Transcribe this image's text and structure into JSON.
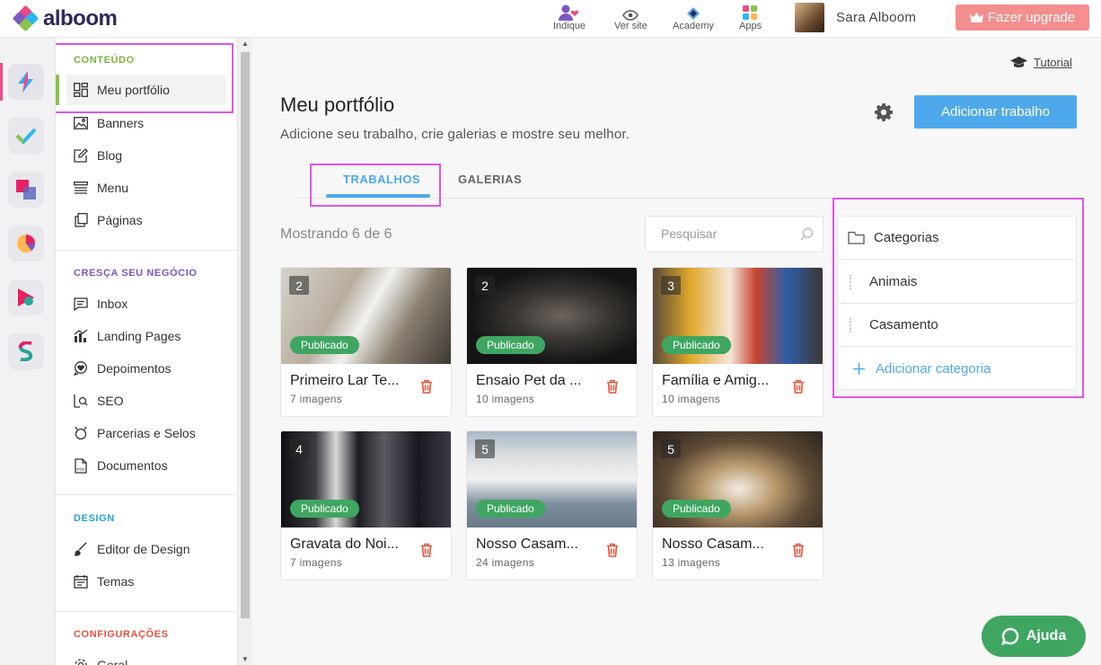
{
  "brand": {
    "name": "alboom"
  },
  "topbar": {
    "nav": [
      {
        "label": "Indique",
        "icon": "people-heart-icon"
      },
      {
        "label": "Ver site",
        "icon": "eye-icon"
      },
      {
        "label": "Academy",
        "icon": "academy-icon"
      },
      {
        "label": "Apps",
        "icon": "apps-grid-icon"
      }
    ],
    "user_name": "Sara Alboom",
    "upgrade_label": "Fazer upgrade"
  },
  "rail": {
    "items": [
      "bolt-app-icon",
      "check-app-icon",
      "squares-app-icon",
      "pie-app-icon",
      "play-app-icon",
      "s-app-icon"
    ]
  },
  "sidebar": {
    "sections": [
      {
        "title": "CONTEÚDO",
        "color": "#7cb342",
        "items": [
          "Meu portfólio",
          "Banners",
          "Blog",
          "Menu",
          "Páginas"
        ]
      },
      {
        "title": "CRESÇA SEU NEGÓCIO",
        "color": "#7e57c2",
        "items": [
          "Inbox",
          "Landing Pages",
          "Depoimentos",
          "SEO",
          "Parcerias e Selos",
          "Documentos"
        ]
      },
      {
        "title": "DESIGN",
        "color": "#29a3d6",
        "items": [
          "Editor de Design",
          "Temas"
        ]
      },
      {
        "title": "CONFIGURAÇÕES",
        "color": "#e5533d",
        "items": [
          "Geral"
        ]
      }
    ]
  },
  "main": {
    "tutorial_label": "Tutorial",
    "title": "Meu portfólio",
    "subtitle": "Adicione seu trabalho, crie galerias e mostre seu melhor.",
    "add_button": "Adicionar trabalho",
    "tabs": [
      {
        "label": "TRABALHOS",
        "active": true
      },
      {
        "label": "GALERIAS",
        "active": false
      }
    ],
    "showing": "Mostrando 6 de 6",
    "search_placeholder": "Pesquisar",
    "status_label": "Publicado",
    "cards": [
      {
        "count": "2",
        "title": "Primeiro Lar Te...",
        "meta": "7 imagens"
      },
      {
        "count": "2",
        "title": "Ensaio Pet da ...",
        "meta": "10 imagens"
      },
      {
        "count": "3",
        "title": "Família e Amig...",
        "meta": "10 imagens"
      },
      {
        "count": "4",
        "title": "Gravata do Noi...",
        "meta": "7 imagens"
      },
      {
        "count": "5",
        "title": "Nosso Casam...",
        "meta": "24 imagens"
      },
      {
        "count": "5",
        "title": "Nosso Casam...",
        "meta": "13 imagens"
      }
    ],
    "categories": {
      "header": "Categorias",
      "items": [
        "Animais",
        "Casamento"
      ],
      "add_label": "Adicionar categoria"
    }
  },
  "help_button": "Ajuda",
  "colors": {
    "accent": "#4ea9ec",
    "published": "#3fa662",
    "upgrade": "#f58e8e",
    "highlight": "#e055e8"
  }
}
